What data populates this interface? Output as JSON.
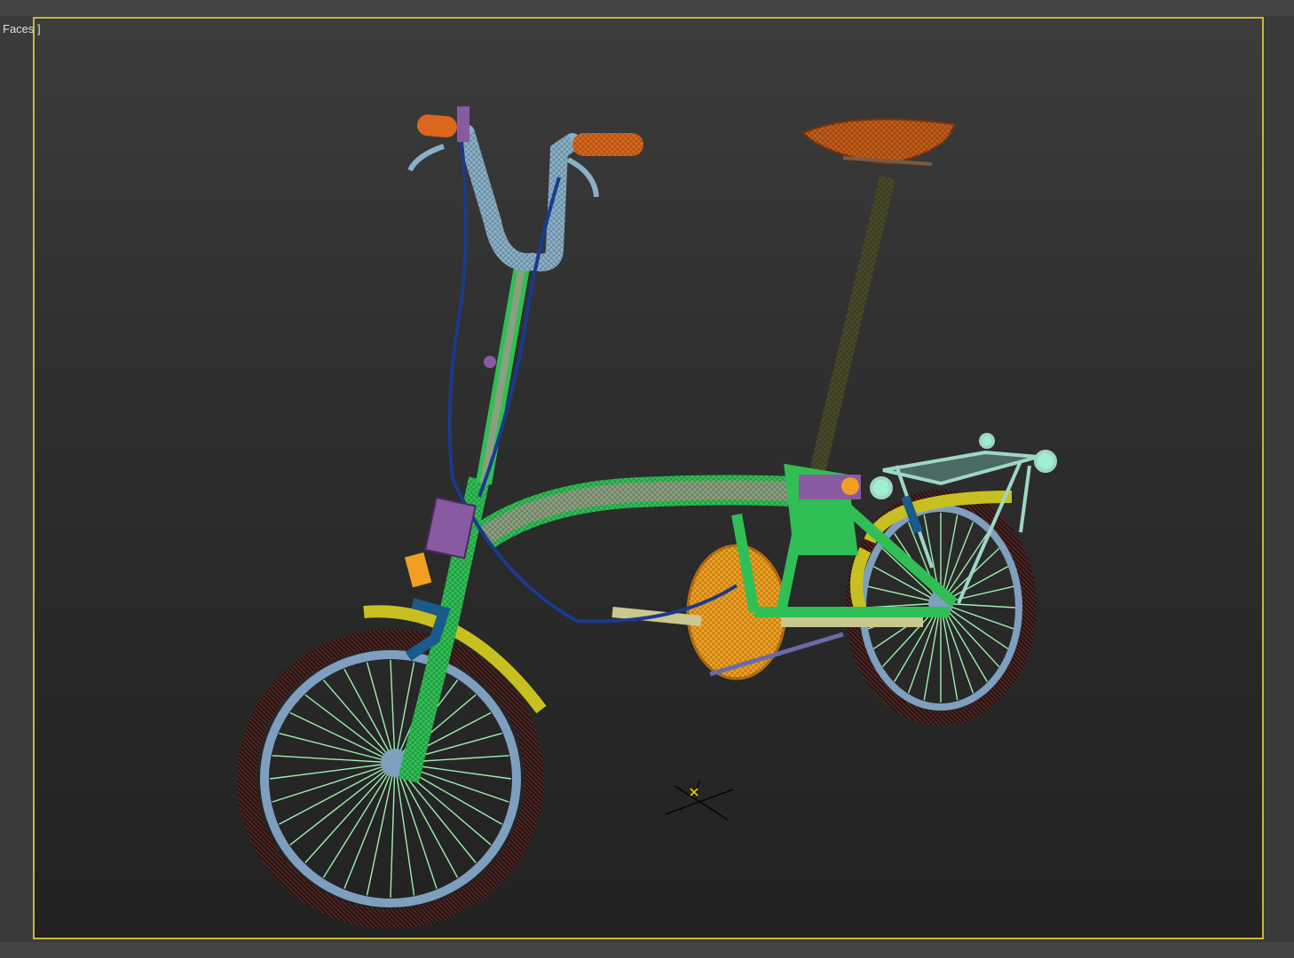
{
  "viewport": {
    "label": "Faces ]",
    "border_color": "#c8b83a",
    "background": "#2e2e2e",
    "render_mode": "wireframe-on-shaded"
  },
  "model": {
    "object": "folding-bicycle",
    "part_colors": {
      "frame": "#2fbf55",
      "tires": "#5a2e2a",
      "rims": "#7f9fc0",
      "spokes": "#9ef0b0",
      "fenders": "#c8c020",
      "grips": "#d9671d",
      "saddle": "#c25a18",
      "seatpost": "#4a4a2a",
      "brake_cables": "#1a3a8c",
      "handlebar": "#8ab0c8",
      "chainring": "#f0a020",
      "rack": "#9fd6c8",
      "brackets": "#8a5aa0"
    }
  },
  "gizmo": {
    "icon": "transform-gizmo-icon",
    "color": "#e8d000"
  }
}
